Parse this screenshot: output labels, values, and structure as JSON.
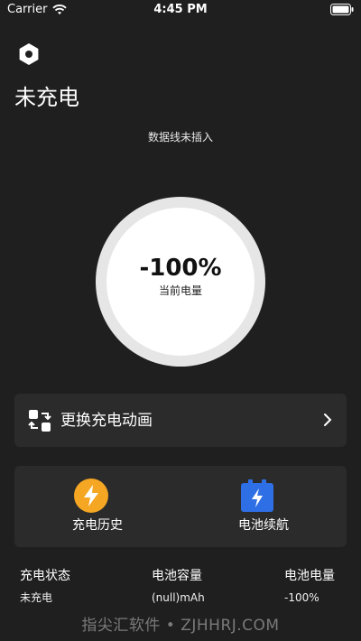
{
  "status_bar": {
    "carrier": "Carrier",
    "time": "4:45 PM"
  },
  "page": {
    "title": "未充电",
    "cable_status": "数据线未插入"
  },
  "gauge": {
    "value": "-100%",
    "caption": "当前电量"
  },
  "switch_animation": {
    "label": "更换充电动画"
  },
  "actions": {
    "history_label": "充电历史",
    "battery_label": "电池续航"
  },
  "info": {
    "status_label": "充电状态",
    "status_value": "未充电",
    "capacity_label": "电池容量",
    "capacity_value": "(null)mAh",
    "level_label": "电池电量",
    "level_value": "-100%"
  },
  "watermark": "指尖汇软件 • ZJHHRJ.COM",
  "colors": {
    "background": "#1f1f1f",
    "card": "#2b2b2b",
    "history_accent": "#f5a623",
    "battery_accent": "#2f6fe6"
  }
}
